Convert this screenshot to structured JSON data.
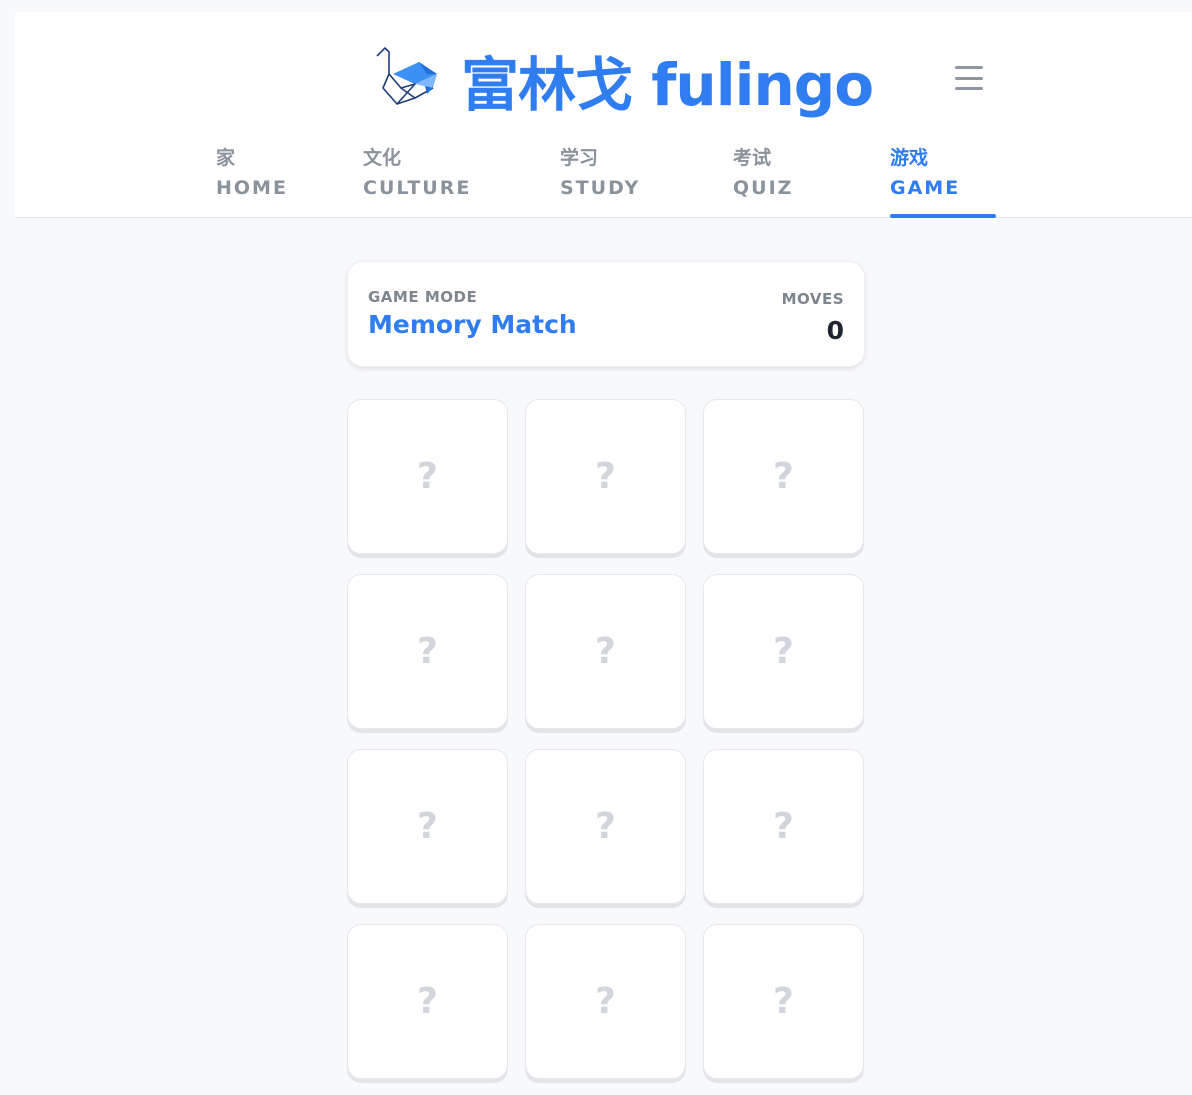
{
  "brand": {
    "title": "富林戈 fulingo",
    "logo_icon": "origami-crane-icon",
    "accent_color": "#2f7df0"
  },
  "header": {
    "menu_icon": "hamburger-menu-icon"
  },
  "nav": {
    "items": [
      {
        "zh": "家",
        "en": "HOME",
        "active": false
      },
      {
        "zh": "文化",
        "en": "CULTURE",
        "active": false
      },
      {
        "zh": "学习",
        "en": "STUDY",
        "active": false
      },
      {
        "zh": "考试",
        "en": "QUIZ",
        "active": false
      },
      {
        "zh": "游戏",
        "en": "GAME",
        "active": true
      }
    ]
  },
  "game": {
    "mode_label": "GAME MODE",
    "mode_value": "Memory Match",
    "moves_label": "MOVES",
    "moves_value": "0"
  },
  "cards": [
    {
      "face": "?"
    },
    {
      "face": "?"
    },
    {
      "face": "?"
    },
    {
      "face": "?"
    },
    {
      "face": "?"
    },
    {
      "face": "?"
    },
    {
      "face": "?"
    },
    {
      "face": "?"
    },
    {
      "face": "?"
    },
    {
      "face": "?"
    },
    {
      "face": "?"
    },
    {
      "face": "?"
    }
  ]
}
